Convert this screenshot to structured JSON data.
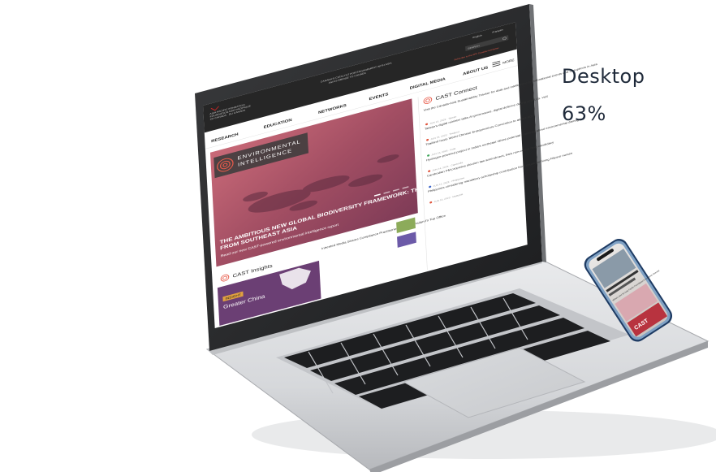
{
  "stat": {
    "label": "Desktop",
    "value": "63%"
  },
  "site": {
    "header": {
      "logo_lines": [
        "ASIA PACIFIC",
        "FOUNDATION",
        "OF CANADA"
      ],
      "logo_lines_fr": [
        "FONDATION",
        "ASIE PACIFIQUE",
        "DU CANADA"
      ],
      "tagline_1": "CANADA'S CATALYST FOR ENGAGEMENT WITH ASIA",
      "tagline_2": "ASIA'S BRIDGE TO CANADA",
      "top_links": [
        "English",
        "Français"
      ],
      "search_placeholder": "SEARCH",
      "subscribe": "Subscribe to the APF Canada newsletter"
    },
    "nav": [
      "RESEARCH",
      "EDUCATION",
      "NETWORKS",
      "EVENTS",
      "DIGITAL MEDIA",
      "ABOUT US"
    ],
    "more_label": "MORE",
    "hero": {
      "badge_line1": "ENVIRONMENTAL",
      "badge_line2": "INTELLIGENCE",
      "headline_1": "THE AMBITIOUS NEW GLOBAL BIODIVERSITY FRAMEWORK: THE VIEW",
      "headline_2": "FROM SOUTHEAST ASIA",
      "sub": "Read our new CAST-powered environmental intelligence report"
    },
    "insights": {
      "title": "CAST Insights",
      "tag": "INSIGHT",
      "region": "Greater China",
      "story": "Inherited Media Shares Compliance Practitioners Path to Thailand's Top Office"
    },
    "connect": {
      "title": "CAST Connect",
      "intro": "Visit the Canada-Asia Sustainability Tracker for data and intelligence on subnational events and disruptions in Asia",
      "items": [
        {
          "meta": "JUN 21, 2023 · Taiwan",
          "text": "Taiwan's digital minister talks AI governance, digital defence during new U.S. visit",
          "color": "#e0553d"
        },
        {
          "meta": "JUN 19, 2023 · Thailand",
          "text": "Thailand hosts World Chinese Entrepreneurs Convention to attract FDI",
          "color": "#e0553d"
        },
        {
          "meta": "JUN 16, 2023 · India",
          "text": "Hydrogen-powered project in India's northeast raises potential concerns about environmental damage",
          "color": "#3fa65a"
        },
        {
          "meta": "JUN 14, 2023 · Cambodia",
          "text": "Cambodian PM proposes election law amendment, bars non-voters from candidacy",
          "color": "#e0553d"
        },
        {
          "meta": "JUN 12, 2023 · Philippines",
          "text": "Philippines considering mandatory scholarship contribution from countries hiring Filipino nurses",
          "color": "#3a63c8"
        },
        {
          "meta": "JUN 10, 2023 · Malaysia",
          "text": "",
          "color": "#e0553d"
        }
      ]
    }
  },
  "phone": {
    "headline": "CAST",
    "caption": "What's next for Asia Pacific Foundation's economic forecast"
  }
}
